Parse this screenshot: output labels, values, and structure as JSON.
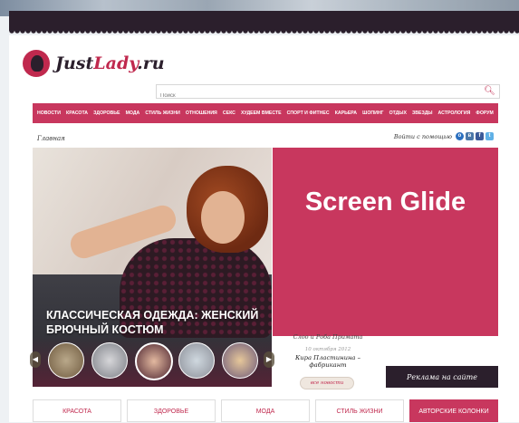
{
  "logo": {
    "text_a": "Just",
    "text_b": "Lady",
    "text_c": ".ru"
  },
  "search": {
    "placeholder": "Поиск",
    "icon": "search-icon"
  },
  "nav": {
    "items": [
      "НОВОСТИ",
      "КРАСОТА",
      "ЗДОРОВЬЕ",
      "МОДА",
      "СТИЛЬ ЖИЗНИ",
      "ОТНОШЕНИЯ",
      "СЕКС",
      "ХУДЕЕМ ВМЕСТЕ",
      "СПОРТ И ФИТНЕС",
      "КАРЬЕРА",
      "ШОПИНГ",
      "ОТДЫХ",
      "ЗВЕЗДЫ",
      "АСТРОЛОГИЯ",
      "ФОРУМ"
    ]
  },
  "breadcrumb": "Главная",
  "login": {
    "label": "Войти с помощью",
    "icons": [
      "openid-icon",
      "vk-icon",
      "facebook-icon",
      "twitter-icon"
    ]
  },
  "hero": {
    "title": "КЛАССИЧЕСКАЯ ОДЕЖДА: ЖЕНСКИЙ БРЮЧНЫЙ КОСТЮМ"
  },
  "overlay": {
    "title": "Screen Glide"
  },
  "news": {
    "cut_title": "Слоо и Роба Примата",
    "date": "10 октября 2012",
    "title": "Кира Пластинина – фабрикант",
    "all_link": "все новости"
  },
  "ad_button": "Реклама на сайте",
  "categories": [
    "КРАСОТА",
    "ЗДОРОВЬЕ",
    "МОДА",
    "СТИЛЬ ЖИЗНИ",
    "АВТОРСКИЕ КОЛОНКИ"
  ],
  "colors": {
    "brand": "#c8375e",
    "dark": "#2b1f2c"
  }
}
